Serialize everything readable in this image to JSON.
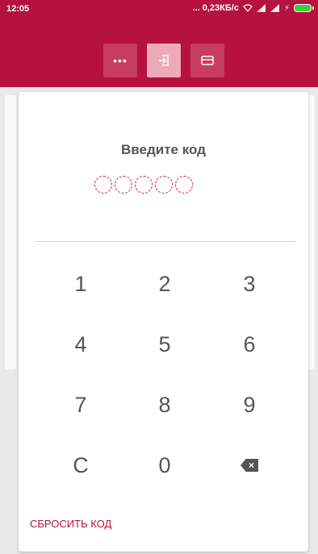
{
  "status_bar": {
    "time": "12:05",
    "network_speed": "... 0,23КБ/с",
    "colors": {
      "background": "#b5123d",
      "battery": "#38d13a"
    },
    "icons": [
      "wifi-icon",
      "signal-icon",
      "signal-icon",
      "charging-icon",
      "battery-icon"
    ]
  },
  "toolbar": {
    "buttons": [
      {
        "icon": "more-icon",
        "glyph": "•••",
        "active": false
      },
      {
        "icon": "login-icon",
        "active": true
      },
      {
        "icon": "card-icon",
        "active": false
      }
    ]
  },
  "pin": {
    "title": "Введите код",
    "length": 5,
    "filled": 0,
    "accent_color": "#d2143f"
  },
  "keypad": {
    "keys": [
      "1",
      "2",
      "3",
      "4",
      "5",
      "6",
      "7",
      "8",
      "9",
      "C",
      "0"
    ],
    "backspace_icon": "backspace-icon"
  },
  "reset_label": "СБРОСИТЬ КОД"
}
